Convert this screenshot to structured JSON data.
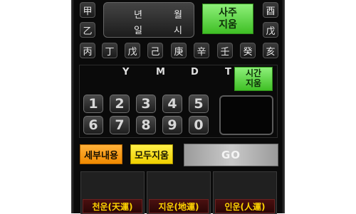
{
  "top_stems": {
    "left": [
      "甲",
      "乙"
    ],
    "right": [
      "酉",
      "戊"
    ]
  },
  "stem_row": [
    "丙",
    "丁",
    "戊",
    "己",
    "庚",
    "辛",
    "壬",
    "癸",
    "亥"
  ],
  "date_display": {
    "year_label": "년",
    "month_label": "월",
    "day_label": "일",
    "hour_label": "시"
  },
  "clear_saju_button": "사주\n지움",
  "ymd_labels": [
    "Y",
    "M",
    "D",
    "T"
  ],
  "clear_time_button": "시간\n지움",
  "number_keys": [
    "1",
    "2",
    "3",
    "4",
    "5",
    "6",
    "7",
    "8",
    "9",
    "0"
  ],
  "detail_button": "세부내용",
  "clear_all_button": "모두지움",
  "go_button": "GO",
  "fortune_tabs": [
    "천운(天運)",
    "지운(地運)",
    "인운(人運)"
  ],
  "colors": {
    "green": "#5fd943",
    "orange": "#f5a020",
    "yellow": "#f5e020",
    "fortune_text": "#ffd400"
  }
}
